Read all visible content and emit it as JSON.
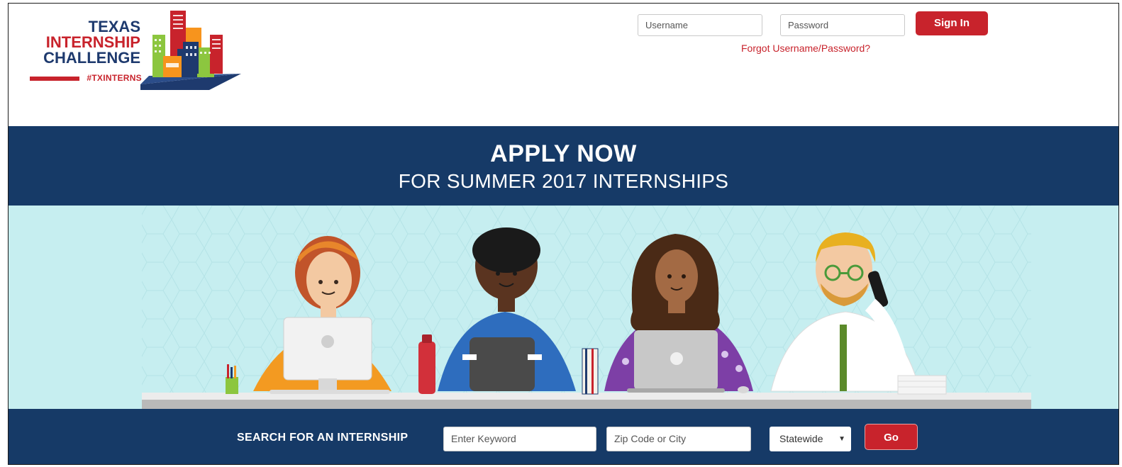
{
  "logo": {
    "line1": "TEXAS",
    "line2": "INTERNSHIP",
    "line3": "CHALLENGE",
    "hashtag": "#TXINTERNS"
  },
  "login": {
    "username_placeholder": "Username",
    "password_placeholder": "Password",
    "sign_in_label": "Sign In",
    "forgot_label": "Forgot Username/Password?"
  },
  "banner": {
    "headline": "APPLY NOW",
    "subheadline": "FOR SUMMER 2017 INTERNSHIPS"
  },
  "search": {
    "label": "SEARCH FOR AN INTERNSHIP",
    "keyword_placeholder": "Enter Keyword",
    "location_placeholder": "Zip Code or City",
    "region_selected": "Statewide",
    "go_label": "Go"
  },
  "colors": {
    "brand_navy": "#163a67",
    "brand_red": "#c8232c",
    "hero_bg": "#c6eef0"
  },
  "icons": {
    "select_arrow": "chevron-down-icon"
  }
}
